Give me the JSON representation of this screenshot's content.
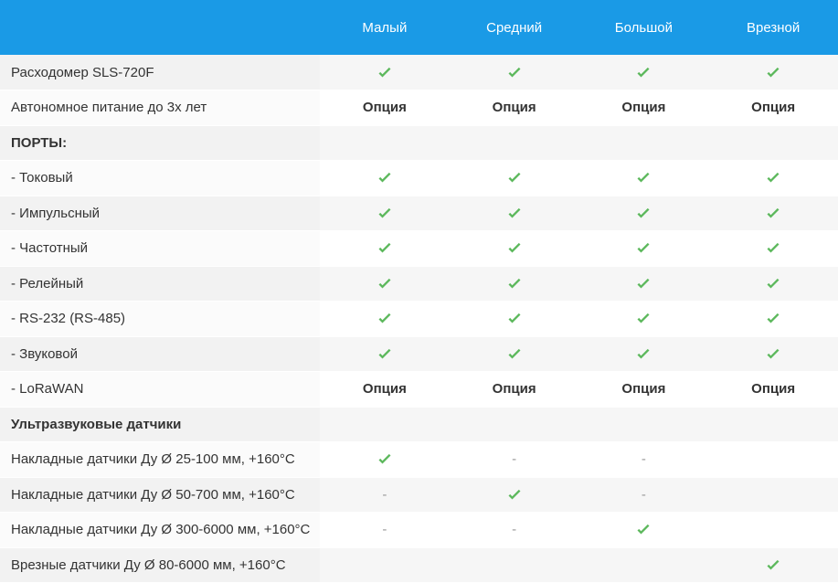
{
  "colors": {
    "header_bg": "#1a9ae6",
    "check": "#5cb85c"
  },
  "header": {
    "columns": [
      "Малый",
      "Средний",
      "Большой",
      "Врезной"
    ]
  },
  "rows": [
    {
      "label": "Расходомер SLS-720F",
      "bold": false,
      "values": [
        "check",
        "check",
        "check",
        "check"
      ]
    },
    {
      "label": "Автономное питание до 3х лет",
      "bold": false,
      "values": [
        "Опция",
        "Опция",
        "Опция",
        "Опция"
      ]
    },
    {
      "label": "ПОРТЫ:",
      "bold": true,
      "values": [
        "",
        "",
        "",
        ""
      ]
    },
    {
      "label": "- Токовый",
      "bold": false,
      "values": [
        "check",
        "check",
        "check",
        "check"
      ]
    },
    {
      "label": "- Импульсный",
      "bold": false,
      "values": [
        "check",
        "check",
        "check",
        "check"
      ]
    },
    {
      "label": "- Частотный",
      "bold": false,
      "values": [
        "check",
        "check",
        "check",
        "check"
      ]
    },
    {
      "label": "- Релейный",
      "bold": false,
      "values": [
        "check",
        "check",
        "check",
        "check"
      ]
    },
    {
      "label": "- RS-232 (RS-485)",
      "bold": false,
      "values": [
        "check",
        "check",
        "check",
        "check"
      ]
    },
    {
      "label": "- Звуковой",
      "bold": false,
      "values": [
        "check",
        "check",
        "check",
        "check"
      ]
    },
    {
      "label": "- LoRaWAN",
      "bold": false,
      "values": [
        "Опция",
        "Опция",
        "Опция",
        "Опция"
      ]
    },
    {
      "label": "Ультразвуковые датчики",
      "bold": true,
      "values": [
        "",
        "",
        "",
        ""
      ]
    },
    {
      "label": "Накладные датчики Ду Ø 25-100 мм, +160°C",
      "bold": false,
      "values": [
        "check",
        "-",
        "-",
        ""
      ]
    },
    {
      "label": "Накладные датчики Ду Ø 50-700 мм, +160°C",
      "bold": false,
      "values": [
        "-",
        "check",
        "-",
        ""
      ]
    },
    {
      "label": "Накладные датчики Ду Ø 300-6000 мм, +160°C",
      "bold": false,
      "values": [
        "-",
        "-",
        "check",
        ""
      ]
    },
    {
      "label": "Врезные датчики Ду Ø 80-6000 мм, +160°C",
      "bold": false,
      "values": [
        "",
        "",
        "",
        "check"
      ]
    }
  ]
}
